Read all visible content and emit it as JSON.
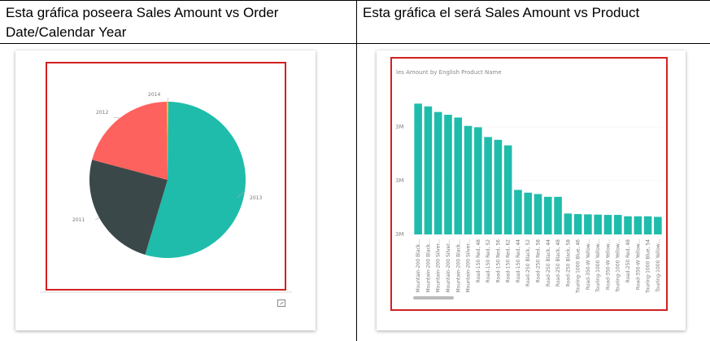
{
  "table": {
    "left_header": "Esta gráfica poseera Sales Amount vs Order Date/Calendar Year",
    "right_header": "Esta gráfica el será Sales Amount vs Product"
  },
  "colors": {
    "teal": "#1fbcab",
    "dark": "#3b4849",
    "red": "#fd625e",
    "yellow": "#f2c80f",
    "highlight_border": "#d42020"
  },
  "chart_data": [
    {
      "type": "pie",
      "title": "",
      "slices": [
        {
          "label": "2013",
          "value": 54.5,
          "color": "#1fbcab"
        },
        {
          "label": "2011",
          "value": 24.5,
          "color": "#3b4849"
        },
        {
          "label": "2012",
          "value": 20.7,
          "color": "#fd625e"
        },
        {
          "label": "2014",
          "value": 0.3,
          "color": "#f2c80f"
        }
      ]
    },
    {
      "type": "bar",
      "title": "les Amount by English Product Name",
      "ylabel": "",
      "y_ticks": [
        "3M",
        "3M",
        "3M"
      ],
      "categories": [
        "Mountain-200 Black...",
        "Mountain-200 Black...",
        "Mountain-200 Silver...",
        "Mountain-200 Silver...",
        "Mountain-200 Black...",
        "Mountain-200 Silver...",
        "Road-150 Red, 48",
        "Road-150 Red, 52",
        "Road-150 Red, 56",
        "Road-150 Red, 62",
        "Road-150 Red, 44",
        "Road-250 Black, 52",
        "Road-250 Red, 58",
        "Road-250 Black, 44",
        "Road-250 Black, 48",
        "Road-250 Black, 58",
        "Touring-1000 Blue, 46",
        "Road-350-W Yellow...",
        "Touring-1000 Yellow...",
        "Road-350-W Yellow...",
        "Touring-1000 Yellow...",
        "Road-250 Red, 48",
        "Road-350-W Yellow...",
        "Touring-1000 Blue, 54",
        "Touring-1000 Yellow..."
      ],
      "values": [
        4.02,
        4.01,
        3.99,
        3.96,
        3.95,
        3.93,
        3.92,
        3.9,
        3.88,
        3.87,
        3.83,
        3.81,
        3.8,
        3.79,
        3.78,
        3.77,
        3.76,
        3.75,
        3.75,
        3.74,
        3.74,
        3.74,
        3.74,
        3.73,
        3.73
      ],
      "display_values": [
        4.02,
        4.01,
        3.99,
        3.98,
        3.97,
        3.94,
        3.935,
        3.9,
        3.89,
        3.87,
        3.71,
        3.7,
        3.695,
        3.685,
        3.685,
        3.625,
        3.623,
        3.622,
        3.621,
        3.62,
        3.62,
        3.615,
        3.615,
        3.615,
        3.613
      ],
      "ylim": [
        3.55,
        4.1
      ]
    }
  ]
}
